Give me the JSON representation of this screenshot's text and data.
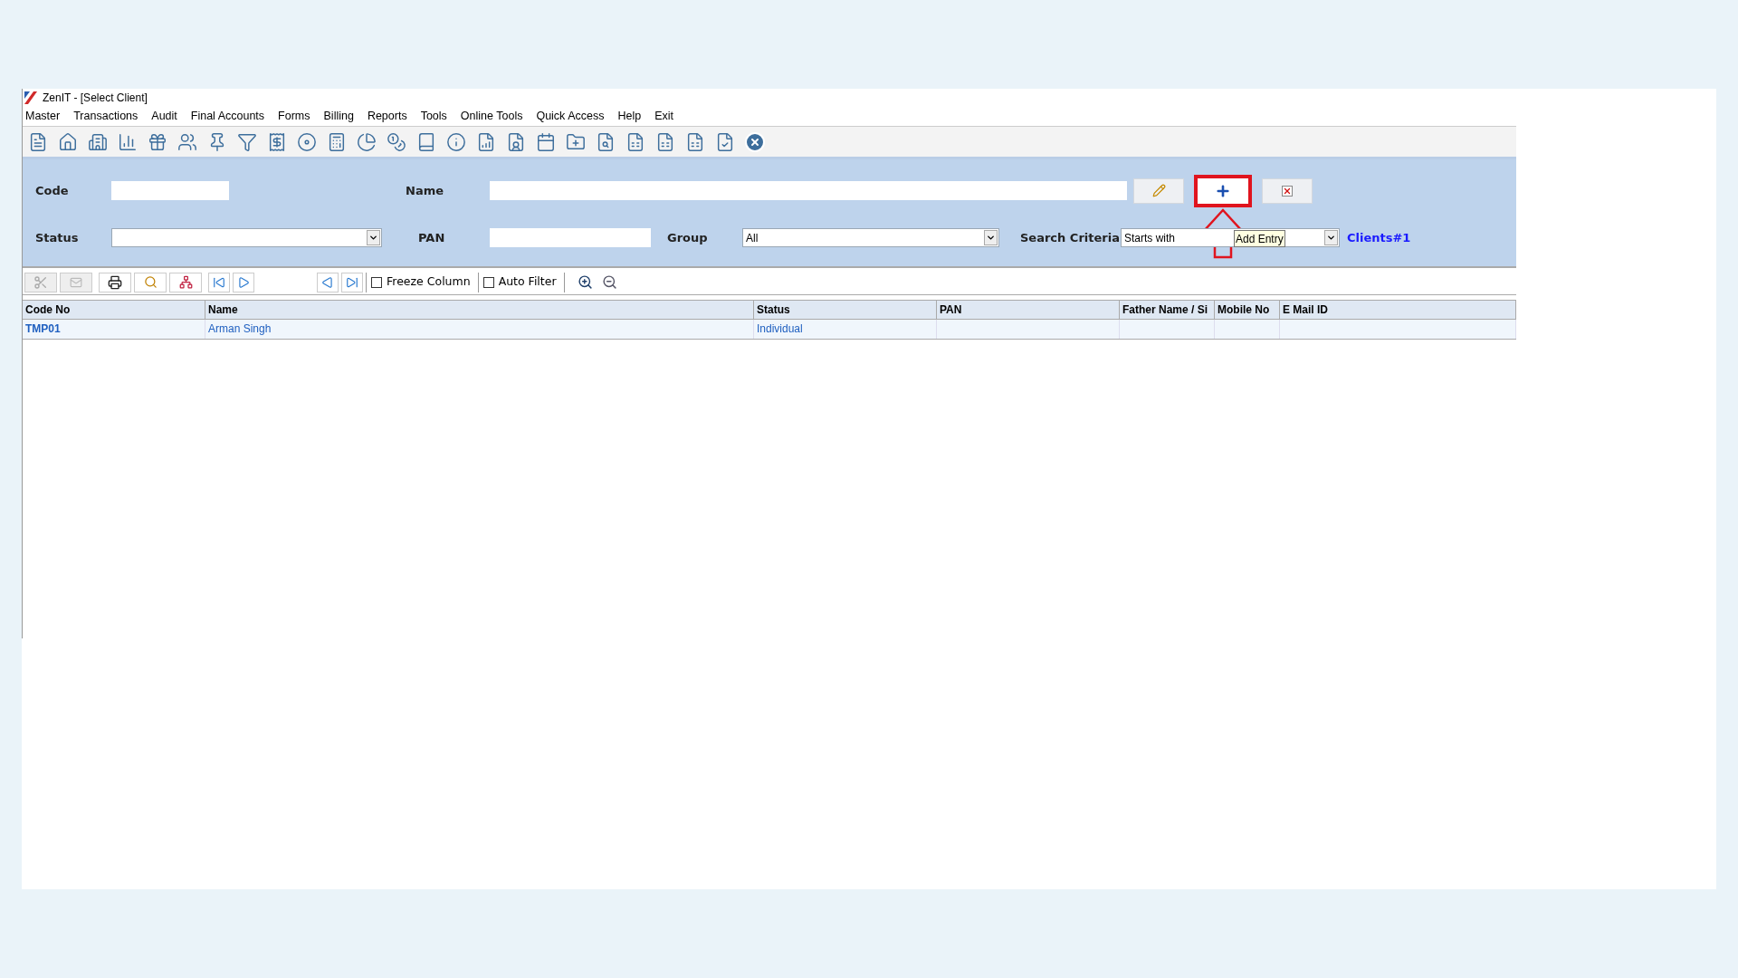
{
  "window": {
    "title": "ZenIT - [Select Client]"
  },
  "menu": [
    "Master",
    "Transactions",
    "Audit",
    "Final Accounts",
    "Forms",
    "Billing",
    "Reports",
    "Tools",
    "Online Tools",
    "Quick Access",
    "Help",
    "Exit"
  ],
  "filters": {
    "code": {
      "label": "Code"
    },
    "name": {
      "label": "Name"
    },
    "status": {
      "label": "Status"
    },
    "pan": {
      "label": "PAN"
    },
    "group": {
      "label": "Group",
      "value": "All"
    },
    "search_criteria": {
      "label": "Search Criteria",
      "value": "Starts with"
    },
    "count_link": "Clients#1"
  },
  "actions": [
    {
      "kind": "edit",
      "highlighted": false
    },
    {
      "kind": "add",
      "highlighted": true,
      "tooltip": "Add Entry"
    },
    {
      "kind": "delete",
      "highlighted": false
    }
  ],
  "grid_toolbar": {
    "checkboxes": [
      {
        "label": "Freeze Column",
        "checked": false
      },
      {
        "label": "Auto Filter",
        "checked": false
      }
    ]
  },
  "table": {
    "columns": [
      "Code No",
      "Name",
      "Status",
      "PAN",
      "Father Name / Si",
      "Mobile No",
      "E Mail ID"
    ],
    "rows": [
      {
        "code_no": "TMP01",
        "name": "Arman Singh",
        "status": "Individual"
      }
    ]
  }
}
